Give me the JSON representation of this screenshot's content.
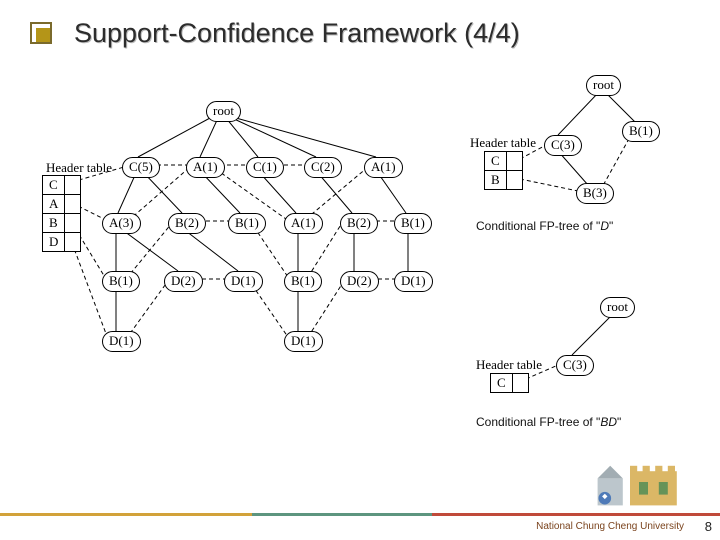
{
  "title": "Support-Confidence Framework (4/4)",
  "left": {
    "header_label": "Header table",
    "header_items": [
      "C",
      "A",
      "B",
      "D"
    ],
    "root": "root",
    "l1": [
      "C(5)",
      "A(1)",
      "C(1)",
      "C(2)",
      "A(1)"
    ],
    "l2": [
      "A(3)",
      "B(2)",
      "B(1)",
      "A(1)",
      "B(2)",
      "B(1)"
    ],
    "l3": [
      "B(1)",
      "D(2)",
      "D(1)",
      "B(1)",
      "D(2)",
      "D(1)"
    ],
    "l4": [
      "D(1)",
      "D(1)"
    ]
  },
  "right_d": {
    "header_label": "Header table",
    "header_items": [
      "C",
      "B"
    ],
    "root": "root",
    "l1": [
      "C(3)",
      "B(1)"
    ],
    "l2": [
      "B(3)"
    ],
    "caption_pre": "Conditional FP-tree of \"",
    "caption_it": "D",
    "caption_post": "\""
  },
  "right_bd": {
    "header_label": "Header table",
    "header_items": [
      "C"
    ],
    "root": "root",
    "l1": [
      "C(3)"
    ],
    "caption_pre": "Conditional FP-tree of \"",
    "caption_it": "BD",
    "caption_post": "\""
  },
  "footer_brand": "National Chung Cheng University",
  "page_number": "8"
}
